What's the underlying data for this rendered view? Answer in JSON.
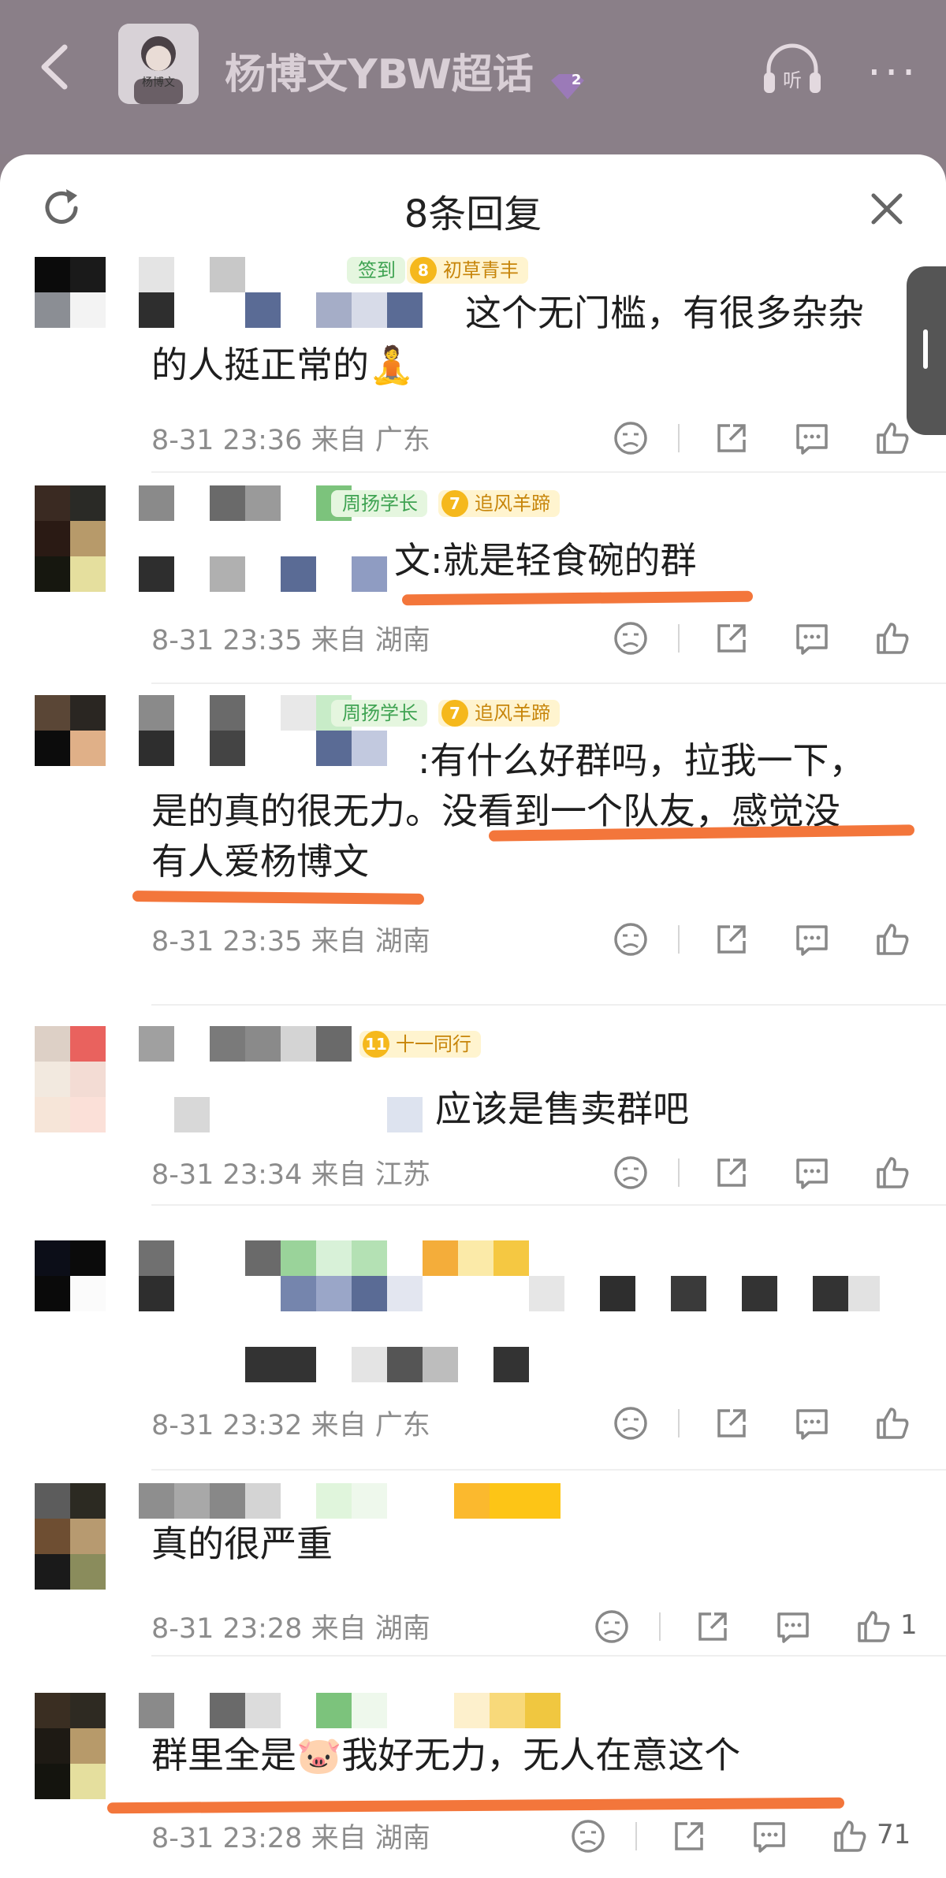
{
  "header": {
    "title": "杨博文YBW超话",
    "avatar_caption": "杨博文",
    "level": "2"
  },
  "sheet": {
    "title": "8条回复"
  },
  "comments": [
    {
      "badges": [
        {
          "text": "签到"
        },
        {
          "level": "8",
          "text": "初草青丰"
        }
      ],
      "text_lines": [
        "这个无门槛，有很多杂杂",
        "的人挺正常的"
      ],
      "emoji": "🧘",
      "time": "8-31 23:36",
      "location": "来自 广东",
      "likes": ""
    },
    {
      "badges": [
        {
          "text": "周扬学长"
        },
        {
          "level": "7",
          "text": "追风羊蹄"
        }
      ],
      "text_lines": [
        "文:就是轻食碗的群"
      ],
      "time": "8-31 23:35",
      "location": "来自 湖南",
      "likes": ""
    },
    {
      "badges": [
        {
          "text": "周扬学长"
        },
        {
          "level": "7",
          "text": "追风羊蹄"
        }
      ],
      "text_lines": [
        ":有什么好群吗，拉我一下，",
        "是的真的很无力。没看到一个队友，感觉没",
        "有人爱杨博文"
      ],
      "time": "8-31 23:35",
      "location": "来自 湖南",
      "likes": ""
    },
    {
      "badges": [
        {
          "level": "11",
          "text": "十一同行"
        }
      ],
      "text_lines": [
        "应该是售卖群吧"
      ],
      "time": "8-31 23:34",
      "location": "来自 江苏",
      "likes": ""
    },
    {
      "badges": [],
      "text_lines": [],
      "time": "8-31 23:32",
      "location": "来自 广东",
      "likes": ""
    },
    {
      "badges": [],
      "text_lines": [
        "真的很严重"
      ],
      "time": "8-31 23:28",
      "location": "来自 湖南",
      "likes": "1"
    },
    {
      "badges": [],
      "text_lines": [
        "群里全是",
        "我好无力，无人在意这个"
      ],
      "emoji": "🐷",
      "time": "8-31 23:28",
      "location": "来自 湖南",
      "likes": "71"
    }
  ],
  "colors": {
    "accent_underline": "#f26a2a",
    "badge_green": "#3fa352",
    "badge_gold": "#f5b81c"
  },
  "icons": [
    "back-icon",
    "listen-icon",
    "more-icon",
    "refresh-icon",
    "close-icon",
    "dislike-icon",
    "share-icon",
    "comment-icon",
    "like-icon"
  ]
}
